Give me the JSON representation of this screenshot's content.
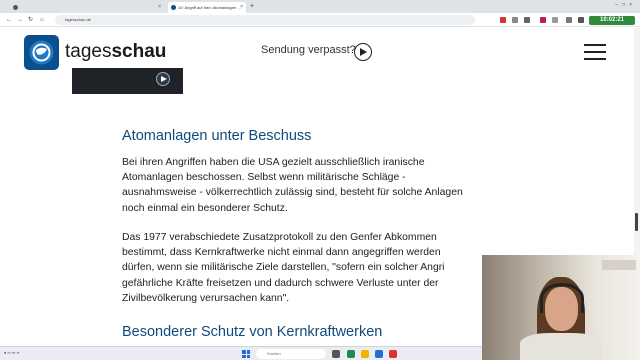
{
  "browser": {
    "tabs": [
      {
        "label": ""
      },
      {
        "label": "10: Angriff auf Iran: Atomanlagen …"
      }
    ],
    "url": "tagesschau.de",
    "clock": "10:02:21"
  },
  "site": {
    "logo_text_light": "tages",
    "logo_text_bold": "schau",
    "sendung_label": "Sendung verpasst?"
  },
  "article": {
    "heading1": "Atomanlagen unter Beschuss",
    "para1": [
      "Bei ihren Angriffen haben die USA gezielt ausschließlich iranische",
      "Atomanlagen beschossen. Selbst wenn militärische Schläge -",
      "ausnahmsweise - völkerrechtlich zulässig sind, besteht für solche Anlagen",
      "noch einmal ein besonderer Schutz."
    ],
    "para2": [
      "Das 1977 verabschiedete Zusatzprotokoll zu den Genfer Abkommen",
      "bestimmt, dass Kernkraftwerke nicht einmal dann angegriffen werden",
      "dürfen, wenn sie militärische Ziele darstellen, \"sofern ein solcher Angri",
      "gefährliche Kräfte freisetzen und dadurch schwere Verluste unter der",
      "Zivilbevölkerung verursachen kann\"."
    ],
    "heading2": "Besonderer Schutz von Kernkraftwerken"
  },
  "taskbar": {
    "search_placeholder": "Suchen"
  },
  "colors": {
    "heading": "#0f4a7e",
    "logo_bg": "#0b4f8c",
    "clock_bg": "#2f8a3a"
  }
}
